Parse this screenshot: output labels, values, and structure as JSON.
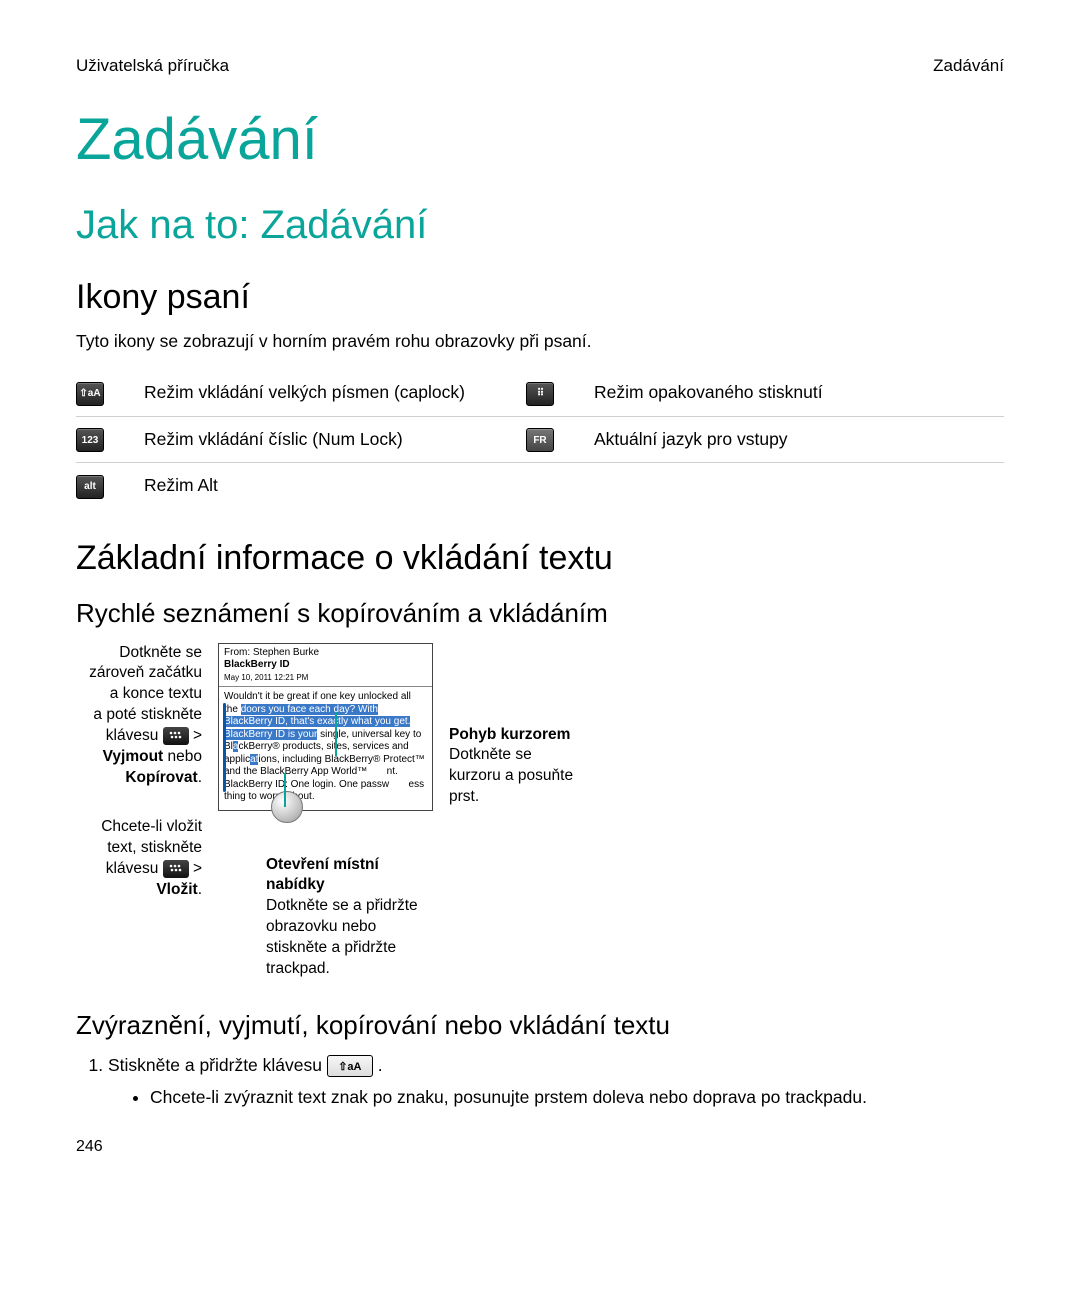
{
  "header": {
    "left": "Uživatelská příručka",
    "right": "Zadávání"
  },
  "title": "Zadávání",
  "section": "Jak na to: Zadávání",
  "icons": {
    "heading": "Ikony psaní",
    "intro": "Tyto ikony se zobrazují v horním pravém rohu obrazovky při psaní.",
    "rows": [
      {
        "icon": "⇧aA",
        "label": "Režim vkládání velkých písmen (caplock)",
        "icon2": "⠿",
        "label2": "Režim opakovaného stisknutí"
      },
      {
        "icon": "123",
        "label": "Režim vkládání číslic (Num Lock)",
        "icon2": "FR",
        "label2": "Aktuální jazyk pro vstupy"
      },
      {
        "icon": "alt",
        "label": "Režim Alt",
        "icon2": "",
        "label2": ""
      }
    ]
  },
  "basics": {
    "heading": "Základní informace o vkládání textu",
    "quick_heading": "Rychlé seznámení s kopírováním a vkládáním",
    "figure": {
      "left1_l1": "Dotkněte se",
      "left1_l2": "zároveň začátku",
      "left1_l3": "a konce textu",
      "left1_l4": "a poté stiskněte",
      "left1_l5": "klávesu",
      "left1_bold1": "Vyjmout",
      "left1_after": " nebo",
      "left1_bold2": "Kopírovat",
      "left2_l1": "Chcete-li vložit",
      "left2_l2": "text, stiskněte",
      "left2_l3": "klávesu",
      "left2_bold": "Vložit",
      "mail_from_label": "From: ",
      "mail_from": "Stephen Burke",
      "mail_subject": "BlackBerry ID",
      "mail_date": "May 10, 2011 12:21 PM",
      "mail_body1": "Wouldn't it be great if one key unlocked all the ",
      "mail_body_hl1": "doors you face each day? With BlackBerry ID, that's exactly what you get. BlackBerry ID is your",
      "mail_body2": " single, universal key to Bl",
      "mail_body_hl2": "a",
      "mail_body3": "ckBerry® products, sites, services and applic",
      "mail_body_hl3": "at",
      "mail_body4": "ions, including BlackBerry® Protect™ and the BlackBerry App World™",
      "mail_body5": "nt. BlackBerry ID: One login. One passw",
      "mail_body6": "ess thing to worry about.",
      "mid_caption_bold": "Otevření místní nabídky",
      "mid_caption_rest": "Dotkněte se a přidržte obrazovku nebo stiskněte a přidržte trackpad.",
      "right_bold": "Pohyb kurzorem",
      "right_rest": "Dotkněte se kurzoru a posuňte prst."
    },
    "highlight_heading": "Zvýraznění, vyjmutí, kopírování nebo vkládání textu",
    "step1_pre": "Stiskněte a přidržte klávesu ",
    "step1_key": "⇧aA",
    "step1_post": " .",
    "bullet1": "Chcete-li zvýraznit text znak po znaku, posunujte prstem doleva nebo doprava po trackpadu."
  },
  "page_number": "246"
}
